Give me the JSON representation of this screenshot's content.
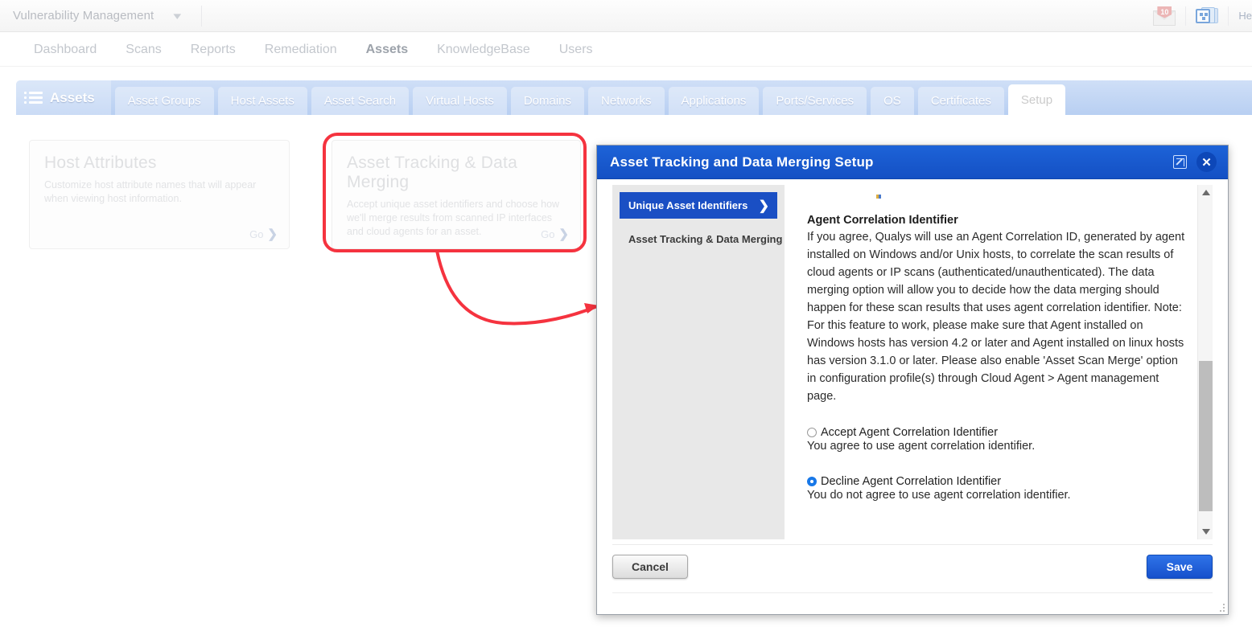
{
  "appbar": {
    "module_title": "Vulnerability Management",
    "caret": "chevron-down",
    "mail_badge": "10",
    "help_label": "He"
  },
  "mainnav": {
    "items": [
      {
        "label": "Dashboard",
        "active": false
      },
      {
        "label": "Scans",
        "active": false
      },
      {
        "label": "Reports",
        "active": false
      },
      {
        "label": "Remediation",
        "active": false
      },
      {
        "label": "Assets",
        "active": true
      },
      {
        "label": "KnowledgeBase",
        "active": false
      },
      {
        "label": "Users",
        "active": false
      }
    ]
  },
  "tabbar": {
    "home_label": "Assets",
    "tabs": [
      {
        "label": "Asset Groups",
        "selected": false
      },
      {
        "label": "Host Assets",
        "selected": false
      },
      {
        "label": "Asset Search",
        "selected": false
      },
      {
        "label": "Virtual Hosts",
        "selected": false
      },
      {
        "label": "Domains",
        "selected": false
      },
      {
        "label": "Networks",
        "selected": false
      },
      {
        "label": "Applications",
        "selected": false
      },
      {
        "label": "Ports/Services",
        "selected": false
      },
      {
        "label": "OS",
        "selected": false
      },
      {
        "label": "Certificates",
        "selected": false
      },
      {
        "label": "Setup",
        "selected": true
      }
    ]
  },
  "cards": [
    {
      "title": "Host Attributes",
      "desc": "Customize host attribute names that will appear when viewing host information.",
      "go_label": "Go"
    },
    {
      "title": "Asset Tracking & Data Merging",
      "desc": "Accept unique asset identifiers and choose how we'll merge results from scanned IP interfaces and cloud agents for an asset.",
      "go_label": "Go"
    }
  ],
  "annotation": {
    "color": "#f5333f",
    "shape": "rounded-rect-highlight-with-curved-arrow"
  },
  "modal": {
    "title": "Asset Tracking and Data Merging Setup",
    "nav": [
      {
        "label": "Unique Asset Identifiers",
        "active": true
      },
      {
        "label": "Asset Tracking & Data Merging",
        "active": false
      }
    ],
    "section_title": "Agent Correlation Identifier",
    "section_body": "If you agree, Qualys will use an Agent Correlation ID, generated by agent installed on Windows and/or Unix hosts, to correlate the scan results of cloud agents or IP scans (authenticated/unauthenticated). The data merging option will allow you to decide how the data merging should happen for these scan results that uses agent correlation identifier. Note: For this feature to work, please make sure that Agent installed on Windows hosts has version 4.2 or later and Agent installed on linux hosts has version 3.1.0 or later. Please also enable 'Asset Scan Merge' option in configuration profile(s) through Cloud Agent > Agent management page.",
    "options": [
      {
        "label": "Accept Agent Correlation Identifier",
        "sub": "You agree to use agent correlation identifier.",
        "selected": false
      },
      {
        "label": "Decline Agent Correlation Identifier",
        "sub": "You do not agree to use agent correlation identifier.",
        "selected": true
      }
    ],
    "cancel_label": "Cancel",
    "save_label": "Save",
    "close_icon": "✕",
    "popout_icon": "popout",
    "accent_color": "#1450c4"
  }
}
